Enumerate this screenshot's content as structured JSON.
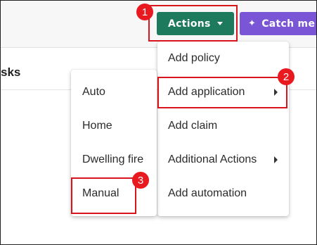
{
  "toolbar": {
    "actions_label": "Actions",
    "catch_label": "Catch me"
  },
  "page": {
    "heading": "sks"
  },
  "actions_menu": {
    "items": [
      {
        "label": "Add policy"
      },
      {
        "label": "Add application"
      },
      {
        "label": "Add claim"
      },
      {
        "label": "Additional Actions"
      },
      {
        "label": "Add automation"
      }
    ]
  },
  "application_submenu": {
    "items": [
      {
        "label": "Auto"
      },
      {
        "label": "Home"
      },
      {
        "label": "Dwelling fire"
      },
      {
        "label": "Manual"
      }
    ]
  },
  "annotations": {
    "step1": "1",
    "step2": "2",
    "step3": "3"
  },
  "colors": {
    "actions_button": "#1e7a5c",
    "catch_button": "#7a55d6",
    "annotation_red": "#e8191f"
  },
  "icons": {
    "actions_caret": "chevron-down-icon",
    "catch_sparkle": "sparkle-icon",
    "submenu_arrow": "chevron-right-icon"
  }
}
